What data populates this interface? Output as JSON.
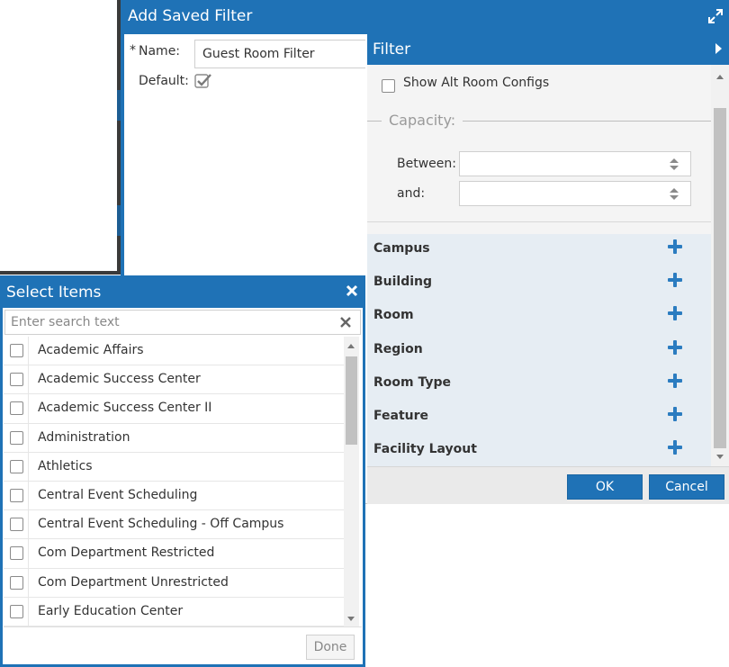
{
  "dialog": {
    "title": "Add Saved Filter",
    "name_label": "Name:",
    "required_mark": "*",
    "name_value": "Guest Room Filter",
    "default_label": "Default:",
    "default_checked": true
  },
  "filter": {
    "title": "Filter",
    "alt_configs_label": "Show Alt Room Configs",
    "capacity": {
      "legend": "Capacity:",
      "between_label": "Between:",
      "and_label": "and:",
      "between_value": "",
      "and_value": ""
    },
    "criteria": [
      "Campus",
      "Building",
      "Room",
      "Region",
      "Room Type",
      "Feature",
      "Facility Layout"
    ]
  },
  "footer": {
    "ok_label": "OK",
    "cancel_label": "Cancel"
  },
  "select_items": {
    "title": "Select Items",
    "search_placeholder": "Enter search text",
    "items": [
      "Academic Affairs",
      "Academic Success Center",
      "Academic Success Center II",
      "Administration",
      "Athletics",
      "Central Event Scheduling",
      "Central Event Scheduling - Off Campus",
      "Com Department Restricted",
      "Com Department Unrestricted",
      "Early Education Center"
    ],
    "done_label": "Done"
  },
  "colors": {
    "header_blue": "#1f72b6",
    "plus_blue": "#2b7cc0",
    "criteria_bg": "#e6edf3"
  }
}
